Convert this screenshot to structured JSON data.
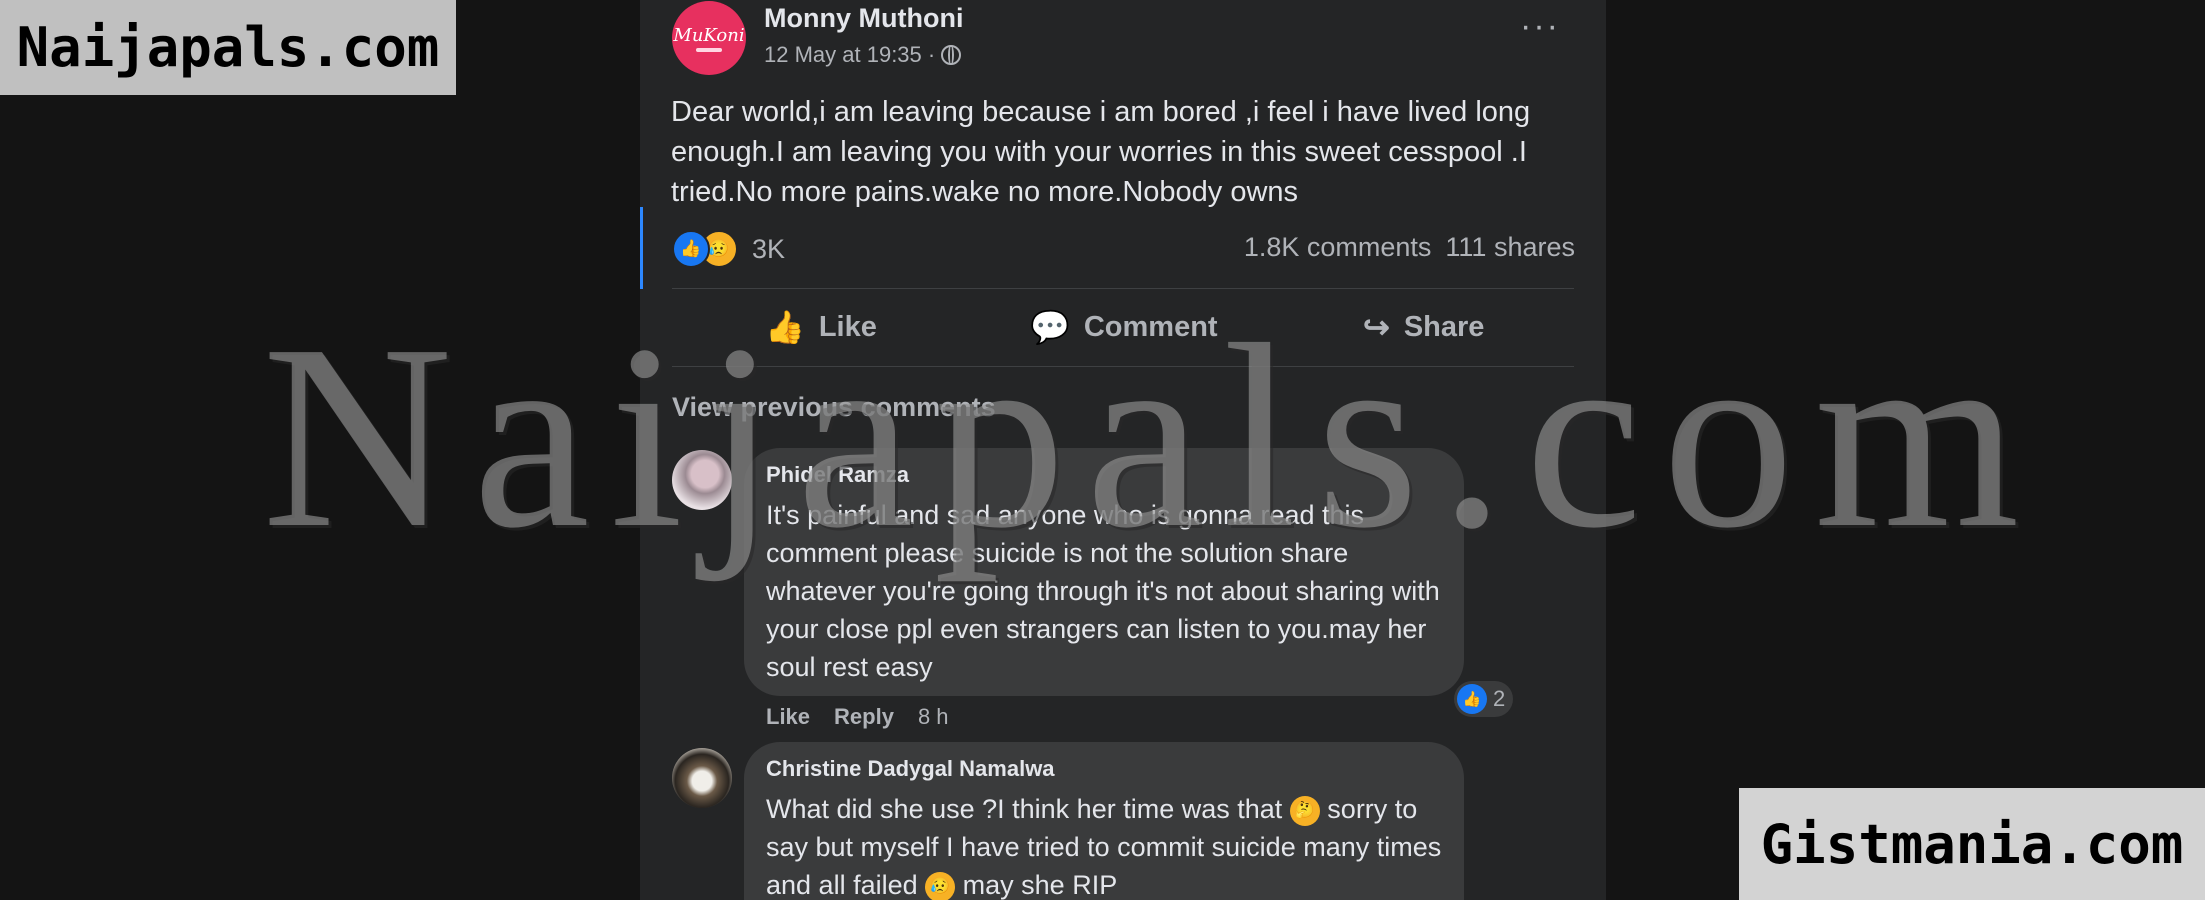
{
  "post": {
    "page_avatar_text": "MuKoni",
    "author": "Monny Muthoni",
    "timestamp": "12 May at 19:35 ·",
    "more_icon": "more-horizontal-icon",
    "text": "Dear world,i am leaving because i am bored ,i feel i have lived long enough.I am leaving you with your worries in this sweet cesspool .I tried.No more pains.wake no more.Nobody owns",
    "reaction_icons": [
      "like-reaction-icon",
      "sad-reaction-icon"
    ],
    "reaction_count": "3K",
    "comments_count": "1.8K comments",
    "shares_count": "111 shares"
  },
  "actions": {
    "like_label": "Like",
    "comment_label": "Comment",
    "share_label": "Share"
  },
  "comments_section": {
    "view_previous_label": "View previous comments",
    "items": [
      {
        "author": "Phidel Ramza",
        "text": "It's painful and sad anyone who is gonna read this comment please suicide is not the solution share whatever you're going through it's not about sharing with your close ppl even strangers can listen to you.may her soul rest easy",
        "like_label": "Like",
        "reply_label": "Reply",
        "time": "8 h",
        "reaction_count": "2"
      },
      {
        "author": "Christine Dadygal Namalwa",
        "text_part1": "What did she use ?I think her time was that",
        "text_part2": "sorry to say but myself I have tried to commit suicide many times and all failed",
        "text_part3": "may she RIP",
        "emojis": [
          "thinking-face-icon",
          "sad-face-icon"
        ]
      }
    ]
  },
  "watermarks": {
    "top_left": "Naijapals.com",
    "center": "Naijapals.com",
    "bottom_right": "Gistmania.com"
  }
}
